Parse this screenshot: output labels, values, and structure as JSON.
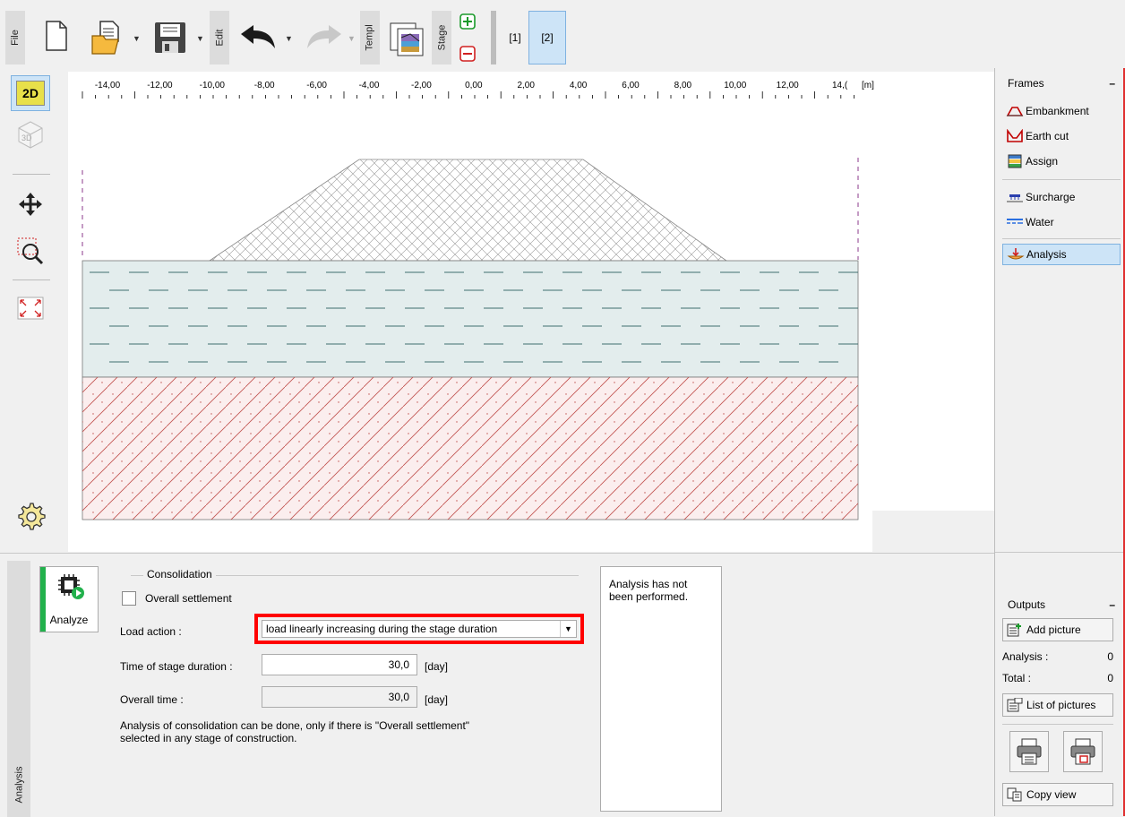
{
  "toolbar": {
    "file_tab": "File",
    "edit_tab": "Edit",
    "templ_tab": "Templ",
    "stage_tab": "Stage",
    "stages": [
      "[1]",
      "[2]"
    ],
    "active_stage": "[2]"
  },
  "left_tools": {
    "view_2d": "2D",
    "view_3d": "3D"
  },
  "ruler": {
    "ticks": [
      "-14,00",
      "-12,00",
      "-10,00",
      "-8,00",
      "-6,00",
      "-4,00",
      "-2,00",
      "0,00",
      "2,00",
      "4,00",
      "6,00",
      "8,00",
      "10,00",
      "12,00",
      "14,("
    ],
    "unit": "[m]"
  },
  "frames": {
    "title": "Frames",
    "items": [
      {
        "label": "Embankment",
        "icon": "embankment-icon"
      },
      {
        "label": "Earth cut",
        "icon": "earth-cut-icon"
      },
      {
        "label": "Assign",
        "icon": "assign-icon"
      },
      {
        "label": "Surcharge",
        "icon": "surcharge-icon"
      },
      {
        "label": "Water",
        "icon": "water-icon"
      },
      {
        "label": "Analysis",
        "icon": "analysis-icon"
      }
    ],
    "selected": "Analysis"
  },
  "outputs": {
    "title": "Outputs",
    "add_picture": "Add picture",
    "analysis_label": "Analysis :",
    "analysis_count": "0",
    "total_label": "Total :",
    "total_count": "0",
    "list_of_pictures": "List of pictures",
    "copy_view": "Copy view"
  },
  "analysis_panel": {
    "side_tab": "Analysis",
    "analyze_button": "Analyze",
    "group_title": "Consolidation",
    "overall_settlement_label": "Overall settlement",
    "overall_settlement_checked": false,
    "load_action_label": "Load action :",
    "load_action_value": "load linearly increasing during the stage duration",
    "time_stage_label": "Time of stage duration :",
    "time_stage_value": "30,0",
    "time_stage_unit": "[day]",
    "overall_time_label": "Overall time :",
    "overall_time_value": "30,0",
    "overall_time_unit": "[day]",
    "note_line1": "Analysis of consolidation can be done, only if there is  \"Overall settlement\"",
    "note_line2": "selected in any stage of construction.",
    "result_line1": "Analysis has not",
    "result_line2": "been performed."
  },
  "colors": {
    "accent_green": "#22b14c",
    "highlight_red": "#ff0000",
    "selection_blue": "#cde4f7",
    "water_layer": "#e3eded",
    "soil_hatch": "#c0504d"
  }
}
